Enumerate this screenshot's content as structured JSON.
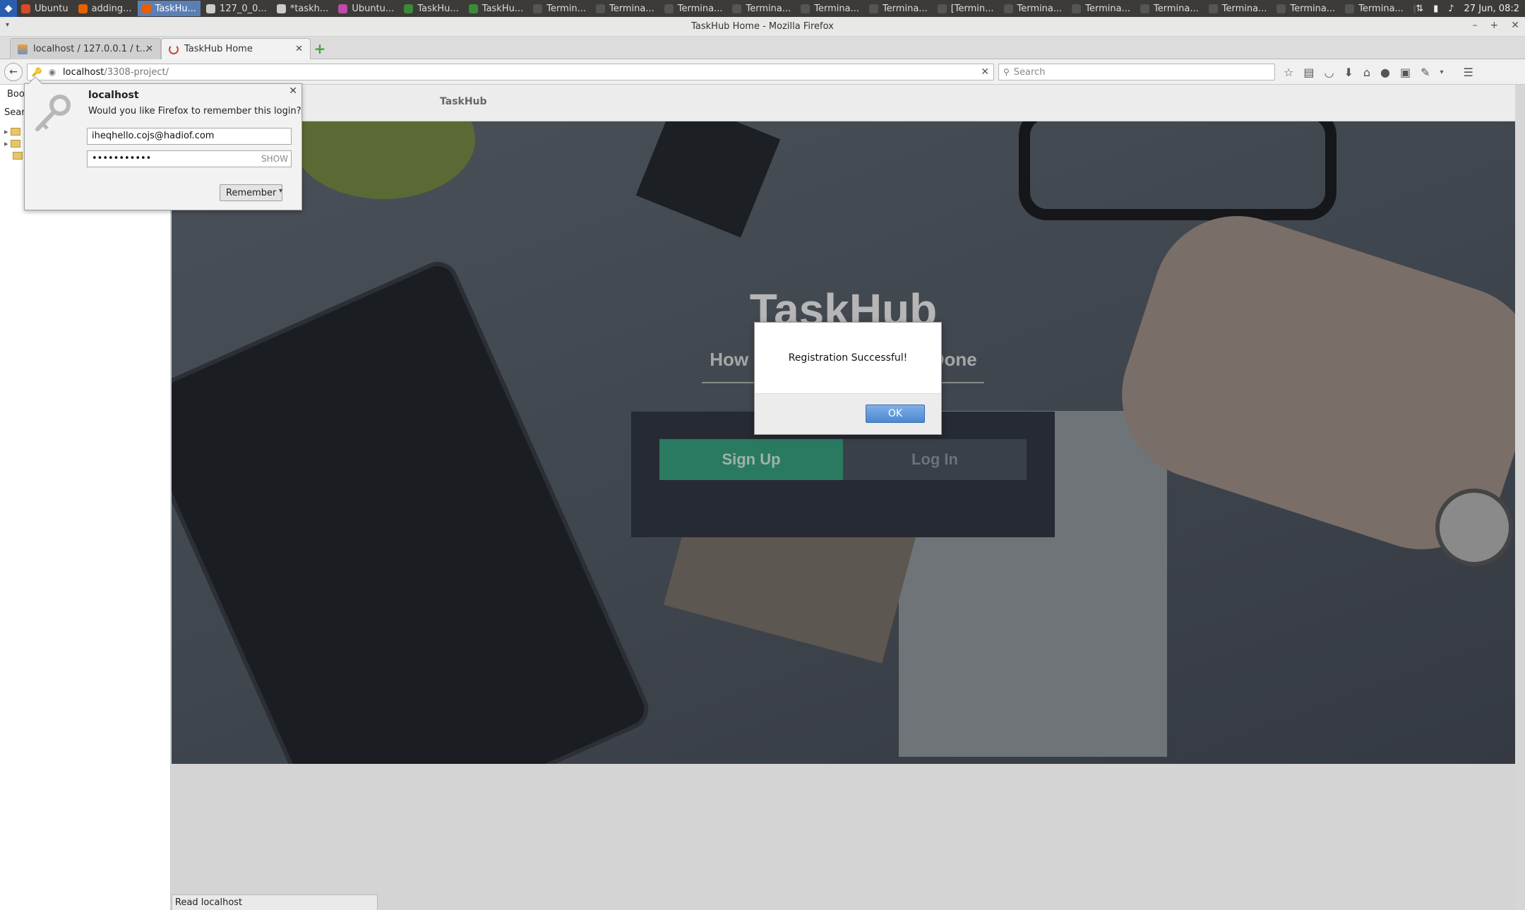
{
  "system_panel": {
    "taskbar": [
      {
        "label": "Ubuntu",
        "icon": "ubuntu-icon",
        "color": "#d94a2a"
      },
      {
        "label": "adding...",
        "icon": "firefox-icon",
        "color": "#e66000"
      },
      {
        "label": "TaskHu...",
        "icon": "firefox-icon",
        "color": "#e66000",
        "active": true
      },
      {
        "label": "127_0_0...",
        "icon": "document-icon",
        "color": "#cccccc"
      },
      {
        "label": "*taskh...",
        "icon": "text-editor-icon",
        "color": "#cccccc"
      },
      {
        "label": "Ubuntu...",
        "icon": "app-icon",
        "color": "#c04aa8"
      },
      {
        "label": "TaskHu...",
        "icon": "chrome-icon",
        "color": "#3a8a3a"
      },
      {
        "label": "TaskHu...",
        "icon": "chrome-icon",
        "color": "#3a8a3a"
      },
      {
        "label": "Termin...",
        "icon": "terminal-icon",
        "color": "#555555"
      },
      {
        "label": "Termina...",
        "icon": "terminal-icon",
        "color": "#555555"
      },
      {
        "label": "Termina...",
        "icon": "terminal-icon",
        "color": "#555555"
      },
      {
        "label": "Termina...",
        "icon": "terminal-icon",
        "color": "#555555"
      },
      {
        "label": "Termina...",
        "icon": "terminal-icon",
        "color": "#555555"
      },
      {
        "label": "Termina...",
        "icon": "terminal-icon",
        "color": "#555555"
      },
      {
        "label": "[Termin...",
        "icon": "terminal-icon",
        "color": "#555555"
      },
      {
        "label": "Termina...",
        "icon": "terminal-icon",
        "color": "#555555"
      },
      {
        "label": "Termina...",
        "icon": "terminal-icon",
        "color": "#555555"
      },
      {
        "label": "Termina...",
        "icon": "terminal-icon",
        "color": "#555555"
      },
      {
        "label": "Termina...",
        "icon": "terminal-icon",
        "color": "#555555"
      },
      {
        "label": "Termina...",
        "icon": "terminal-icon",
        "color": "#555555"
      },
      {
        "label": "Termina...",
        "icon": "terminal-icon",
        "color": "#555555"
      },
      {
        "label": "Termina...",
        "icon": "terminal-icon",
        "color": "#555555"
      }
    ],
    "clock": "27 Jun, 08:2"
  },
  "window": {
    "title": "TaskHub Home - Mozilla Firefox"
  },
  "tabs": [
    {
      "label": "localhost / 127.0.0.1 / t...",
      "selected": false
    },
    {
      "label": "TaskHub Home",
      "selected": true
    }
  ],
  "navbar": {
    "url_host": "localhost",
    "url_path": "/3308-project/",
    "search_placeholder": "Search"
  },
  "sidebar": {
    "title": "Boo",
    "search_label": "Sear"
  },
  "page": {
    "brand": "TaskHub",
    "hero_title": "TaskHub",
    "hero_subtitle": "How Bu                              Done",
    "signup_label": "Sign Up",
    "login_label": "Log In"
  },
  "status_bar": "Read localhost",
  "alert": {
    "message": "Registration Successful!",
    "ok_label": "OK"
  },
  "password_doorhanger": {
    "host": "localhost",
    "question": "Would you like Firefox to remember this login?",
    "username": "iheqhello.cojs@hadiof.com",
    "password_mask": "•••••••••••",
    "show_label": "SHOW",
    "remember_label": "Remember"
  },
  "colors": {
    "accent_green": "#2a7a61",
    "system_panel": "#3c3b37",
    "ok_button": "#4c88d0"
  }
}
